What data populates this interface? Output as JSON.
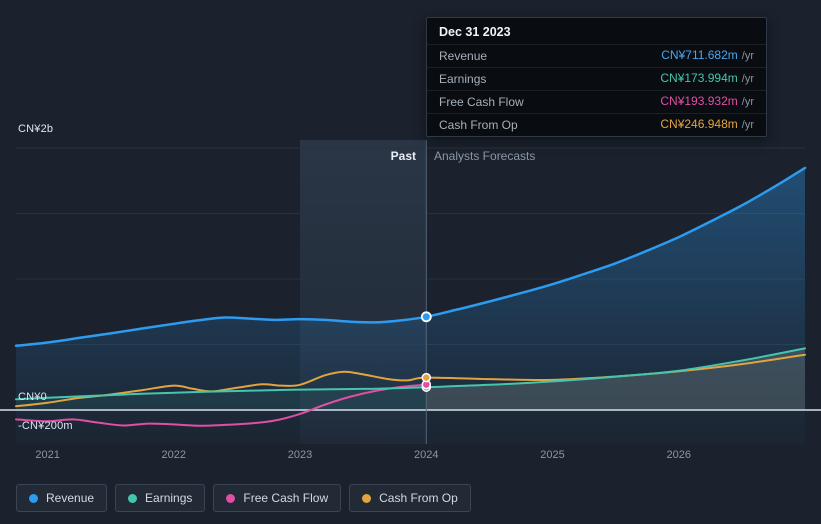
{
  "page": {
    "background_color": "#1b222d"
  },
  "tooltip": {
    "title": "Dec 31 2023",
    "rows": [
      {
        "id": "revenue",
        "label": "Revenue",
        "value": "CN¥711.682m",
        "suffix": "/yr",
        "color": "#4aa6f2"
      },
      {
        "id": "earnings",
        "label": "Earnings",
        "value": "CN¥173.994m",
        "suffix": "/yr",
        "color": "#46c5ae"
      },
      {
        "id": "free-cash-flow",
        "label": "Free Cash Flow",
        "value": "CN¥193.932m",
        "suffix": "/yr",
        "color": "#e04fa5"
      },
      {
        "id": "cash-from-op",
        "label": "Cash From Op",
        "value": "CN¥246.948m",
        "suffix": "/yr",
        "color": "#e2a43e"
      }
    ]
  },
  "chart_data": {
    "type": "line",
    "unit": "CN¥ millions",
    "marker_date": "Dec 31 2023",
    "x_axis": {
      "range": [
        2020.75,
        2027.0
      ],
      "ticks": [
        2021,
        2022,
        2023,
        2024,
        2025,
        2026
      ],
      "tick_labels": [
        "2021",
        "2022",
        "2023",
        "2024",
        "2025",
        "2026"
      ]
    },
    "y_axis": {
      "labels": [
        {
          "text": "CN¥2b",
          "value": 2000
        },
        {
          "text": "CN¥0",
          "value": 0
        },
        {
          "text": "-CN¥200m",
          "value": -200
        }
      ],
      "gridline_values": [
        2000,
        1500,
        1000,
        500,
        0
      ]
    },
    "divider": {
      "x": 2024,
      "past_label": "Past",
      "forecast_label": "Analysts Forecasts"
    },
    "highlight_band": {
      "from": 2023,
      "to": 2024
    },
    "series": [
      {
        "id": "revenue",
        "name": "Revenue",
        "color": "#2d9bf0",
        "past": [
          [
            2020.75,
            490
          ],
          [
            2021,
            515
          ],
          [
            2021.25,
            550
          ],
          [
            2021.5,
            585
          ],
          [
            2021.75,
            622
          ],
          [
            2022,
            658
          ],
          [
            2022.2,
            685
          ],
          [
            2022.4,
            706
          ],
          [
            2022.6,
            698
          ],
          [
            2022.8,
            688
          ],
          [
            2023,
            694
          ],
          [
            2023.2,
            688
          ],
          [
            2023.4,
            674
          ],
          [
            2023.6,
            669
          ],
          [
            2023.8,
            684
          ],
          [
            2024,
            711.682
          ]
        ],
        "forecast": [
          [
            2024,
            711.682
          ],
          [
            2024.25,
            768
          ],
          [
            2024.5,
            828
          ],
          [
            2024.75,
            892
          ],
          [
            2025,
            960
          ],
          [
            2025.25,
            1038
          ],
          [
            2025.5,
            1120
          ],
          [
            2025.75,
            1216
          ],
          [
            2026,
            1320
          ],
          [
            2026.25,
            1438
          ],
          [
            2026.5,
            1562
          ],
          [
            2026.75,
            1700
          ],
          [
            2027,
            1848
          ]
        ]
      },
      {
        "id": "earnings",
        "name": "Earnings",
        "color": "#46c5ae",
        "past": [
          [
            2020.75,
            82
          ],
          [
            2021,
            93
          ],
          [
            2021.25,
            104
          ],
          [
            2021.5,
            114
          ],
          [
            2021.75,
            124
          ],
          [
            2022,
            132
          ],
          [
            2022.25,
            139
          ],
          [
            2022.5,
            145
          ],
          [
            2022.75,
            151
          ],
          [
            2023,
            156
          ],
          [
            2023.25,
            159
          ],
          [
            2023.5,
            161
          ],
          [
            2023.75,
            166
          ],
          [
            2024,
            173.994
          ]
        ],
        "forecast": [
          [
            2024,
            173.994
          ],
          [
            2024.5,
            192
          ],
          [
            2025,
            218
          ],
          [
            2025.5,
            255
          ],
          [
            2026,
            300
          ],
          [
            2026.5,
            378
          ],
          [
            2027,
            470
          ]
        ]
      },
      {
        "id": "free-cash-flow",
        "name": "Free Cash Flow",
        "color": "#e04fa5",
        "past": [
          [
            2020.75,
            -72
          ],
          [
            2021,
            -86
          ],
          [
            2021.2,
            -72
          ],
          [
            2021.4,
            -96
          ],
          [
            2021.6,
            -118
          ],
          [
            2021.8,
            -104
          ],
          [
            2022,
            -110
          ],
          [
            2022.2,
            -120
          ],
          [
            2022.4,
            -114
          ],
          [
            2022.6,
            -103
          ],
          [
            2022.8,
            -80
          ],
          [
            2023,
            -30
          ],
          [
            2023.2,
            42
          ],
          [
            2023.4,
            102
          ],
          [
            2023.6,
            146
          ],
          [
            2023.8,
            176
          ],
          [
            2024,
            193.932
          ]
        ],
        "forecast": []
      },
      {
        "id": "cash-from-op",
        "name": "Cash From Op",
        "color": "#e2a43e",
        "past": [
          [
            2020.75,
            28
          ],
          [
            2021,
            56
          ],
          [
            2021.25,
            92
          ],
          [
            2021.5,
            118
          ],
          [
            2021.75,
            152
          ],
          [
            2022,
            186
          ],
          [
            2022.15,
            162
          ],
          [
            2022.3,
            142
          ],
          [
            2022.5,
            170
          ],
          [
            2022.7,
            196
          ],
          [
            2022.85,
            186
          ],
          [
            2023,
            192
          ],
          [
            2023.2,
            266
          ],
          [
            2023.35,
            292
          ],
          [
            2023.5,
            272
          ],
          [
            2023.7,
            236
          ],
          [
            2023.85,
            226
          ],
          [
            2024,
            246.948
          ]
        ],
        "forecast": [
          [
            2024,
            246.948
          ],
          [
            2024.5,
            236
          ],
          [
            2025,
            230
          ],
          [
            2025.5,
            256
          ],
          [
            2026,
            296
          ],
          [
            2026.5,
            350
          ],
          [
            2027,
            422
          ]
        ]
      }
    ]
  },
  "legend": {
    "items": [
      {
        "id": "revenue",
        "label": "Revenue",
        "color": "#2d9bf0"
      },
      {
        "id": "earnings",
        "label": "Earnings",
        "color": "#46c5ae"
      },
      {
        "id": "free-cash-flow",
        "label": "Free Cash Flow",
        "color": "#e04fa5"
      },
      {
        "id": "cash-from-op",
        "label": "Cash From Op",
        "color": "#e2a43e"
      }
    ]
  }
}
